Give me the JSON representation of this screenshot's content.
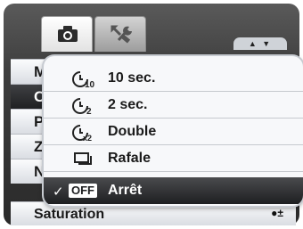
{
  "tabs": [
    {
      "name": "camera",
      "icon": "camera-icon",
      "active": true
    },
    {
      "name": "setup",
      "icon": "wrench-icon",
      "active": false
    }
  ],
  "scroll_arrows": "▲ ▼",
  "menu_rows": [
    "M",
    "C",
    "P",
    "Z",
    "N",
    "Saturation"
  ],
  "saturation_indicator": "●±",
  "popup": {
    "options": [
      {
        "label": "10 sec.",
        "icon": "self-timer-10-icon"
      },
      {
        "label": "2 sec.",
        "icon": "self-timer-2-icon"
      },
      {
        "label": "Double",
        "icon": "self-timer-double-icon"
      },
      {
        "label": "Rafale",
        "icon": "burst-icon"
      },
      {
        "label": "Arrêt",
        "icon": "off-icon",
        "selected": true
      }
    ],
    "check": "✓",
    "off_badge": "OFF"
  }
}
